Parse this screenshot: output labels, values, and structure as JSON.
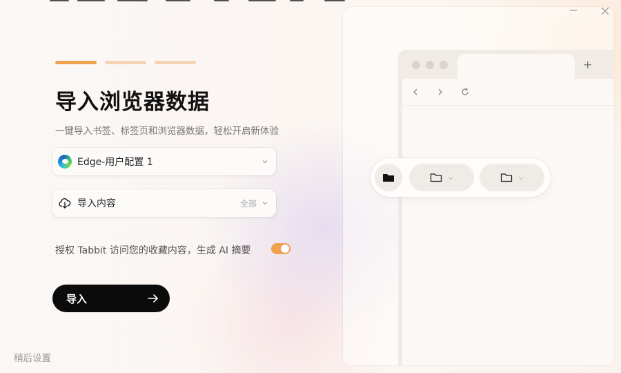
{
  "progress": {
    "steps": 3,
    "active": 1
  },
  "title": "导入浏览器数据",
  "subtitle": "一键导入书签、标签页和浏览器数据，轻松开启新体验",
  "browser_select": {
    "label": "Edge-用户配置 1",
    "icon": "edge-icon"
  },
  "content_select": {
    "label": "导入内容",
    "value": "全部",
    "icon": "cloud-download-icon"
  },
  "consent": {
    "text": "授权 Tabbit 访问您的收藏内容，生成 AI 摘要",
    "enabled": true
  },
  "import_button": {
    "label": "导入"
  },
  "later_link": "稍后设置",
  "preview": {
    "plus": "+"
  },
  "colors": {
    "accent": "#f0a04f",
    "progress_inactive": "#f4d2b4",
    "button_bg": "#0b0b0b"
  }
}
